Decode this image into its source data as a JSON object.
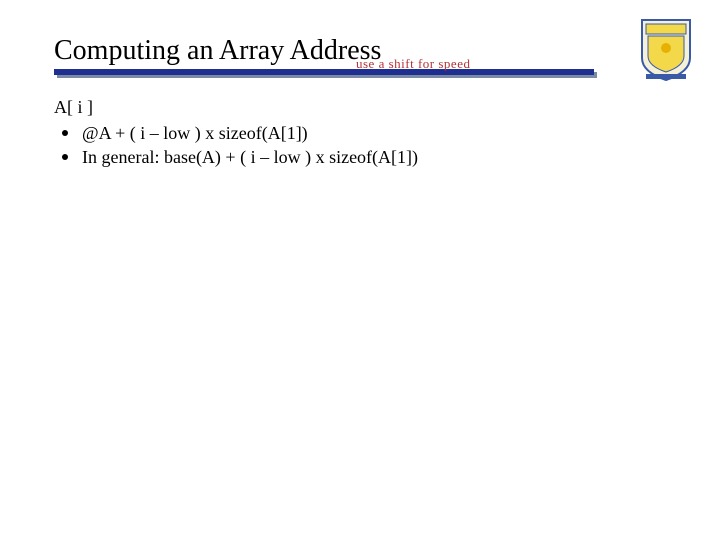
{
  "title": "Computing an Array Address",
  "overlap_text": "use a shift for speed",
  "content": {
    "line1": "A[ i ]",
    "bullet1": "@A + ( i – low ) x sizeof(A[1])",
    "bullet2": "In general: base(A) + ( i – low ) x sizeof(A[1])"
  },
  "logo": {
    "name": "university-of-delaware-logo"
  }
}
